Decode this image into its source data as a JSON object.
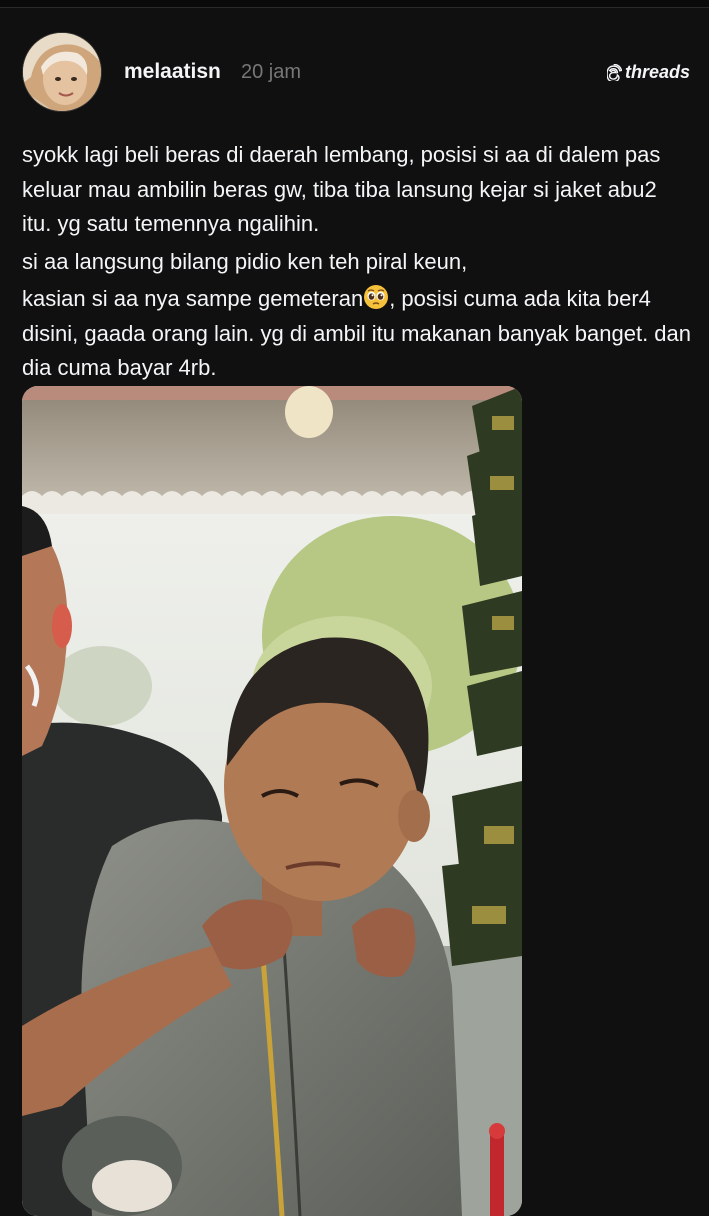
{
  "post": {
    "username": "melaatisn",
    "timestamp": "20 jam",
    "paragraphs": [
      "syokk lagi beli beras di daerah lembang, posisi si aa di dalem pas keluar mau ambilin beras gw, tiba tiba lansung kejar si jaket abu2 itu. yg satu temennya ngalihin.",
      "si aa langsung bilang pidio ken teh piral keun,"
    ],
    "last_paragraph_before_emoji": "kasian si aa nya sampe gemeteran",
    "last_paragraph_after_emoji": ", posisi cuma ada kita ber4 disini, gaada orang lain. yg di ambil itu makanan banyak banget. dan dia cuma bayar 4rb.",
    "emoji_icon": "pleading-face-icon"
  },
  "brand": {
    "name": "threads",
    "icon": "threads-logo-icon"
  },
  "media": {
    "type": "photo"
  },
  "colors": {
    "background": "#101010",
    "text": "#f3f5f7",
    "muted": "#777777"
  }
}
